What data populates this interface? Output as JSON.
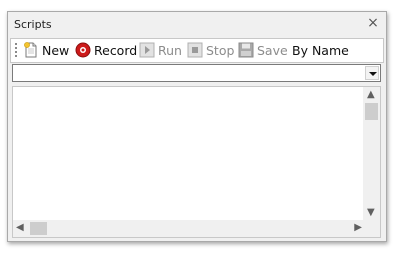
{
  "panel": {
    "title": "Scripts",
    "close_glyph": "×"
  },
  "toolbar": {
    "buttons": [
      {
        "label": "New",
        "icon": "new-file-icon",
        "enabled": true
      },
      {
        "label": "Record",
        "icon": "record-icon",
        "enabled": true
      },
      {
        "label": "Run",
        "icon": "run-icon",
        "enabled": false
      },
      {
        "label": "Stop",
        "icon": "stop-icon",
        "enabled": false
      },
      {
        "label": "Save",
        "icon": "save-icon",
        "enabled": false
      },
      {
        "label": "By Name",
        "enabled": true
      }
    ]
  },
  "script_selector": {
    "value": ""
  },
  "scrollbars": {
    "up": "▲",
    "down": "▼",
    "left": "◀",
    "right": "▶"
  },
  "colors": {
    "record": "#cc1a1a",
    "disabled": "#8c8c8c"
  }
}
